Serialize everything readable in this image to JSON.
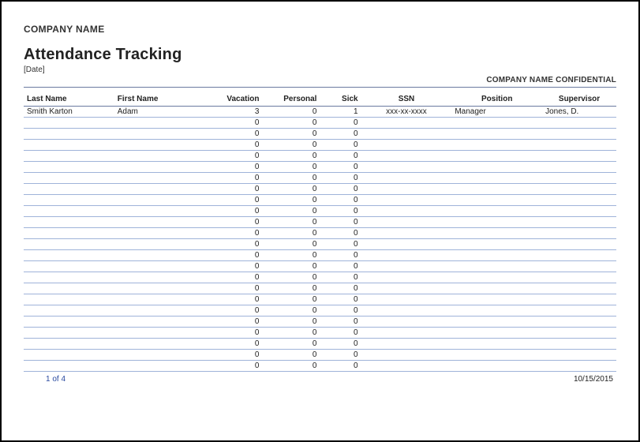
{
  "header": {
    "company_name": "COMPANY NAME",
    "title": "Attendance Tracking",
    "date_placeholder": "[Date]",
    "confidential": "COMPANY NAME CONFIDENTIAL"
  },
  "table": {
    "columns": {
      "last_name": "Last Name",
      "first_name": "First Name",
      "vacation": "Vacation",
      "personal": "Personal",
      "sick": "Sick",
      "ssn": "SSN",
      "position": "Position",
      "supervisor": "Supervisor"
    },
    "rows": [
      {
        "last_name": "Smith Karton",
        "first_name": "Adam",
        "vacation": "3",
        "personal": "0",
        "sick": "1",
        "ssn": "xxx-xx-xxxx",
        "position": "Manager",
        "supervisor": "Jones, D."
      },
      {
        "last_name": "",
        "first_name": "",
        "vacation": "0",
        "personal": "0",
        "sick": "0",
        "ssn": "",
        "position": "",
        "supervisor": ""
      },
      {
        "last_name": "",
        "first_name": "",
        "vacation": "0",
        "personal": "0",
        "sick": "0",
        "ssn": "",
        "position": "",
        "supervisor": ""
      },
      {
        "last_name": "",
        "first_name": "",
        "vacation": "0",
        "personal": "0",
        "sick": "0",
        "ssn": "",
        "position": "",
        "supervisor": ""
      },
      {
        "last_name": "",
        "first_name": "",
        "vacation": "0",
        "personal": "0",
        "sick": "0",
        "ssn": "",
        "position": "",
        "supervisor": ""
      },
      {
        "last_name": "",
        "first_name": "",
        "vacation": "0",
        "personal": "0",
        "sick": "0",
        "ssn": "",
        "position": "",
        "supervisor": ""
      },
      {
        "last_name": "",
        "first_name": "",
        "vacation": "0",
        "personal": "0",
        "sick": "0",
        "ssn": "",
        "position": "",
        "supervisor": ""
      },
      {
        "last_name": "",
        "first_name": "",
        "vacation": "0",
        "personal": "0",
        "sick": "0",
        "ssn": "",
        "position": "",
        "supervisor": ""
      },
      {
        "last_name": "",
        "first_name": "",
        "vacation": "0",
        "personal": "0",
        "sick": "0",
        "ssn": "",
        "position": "",
        "supervisor": ""
      },
      {
        "last_name": "",
        "first_name": "",
        "vacation": "0",
        "personal": "0",
        "sick": "0",
        "ssn": "",
        "position": "",
        "supervisor": ""
      },
      {
        "last_name": "",
        "first_name": "",
        "vacation": "0",
        "personal": "0",
        "sick": "0",
        "ssn": "",
        "position": "",
        "supervisor": ""
      },
      {
        "last_name": "",
        "first_name": "",
        "vacation": "0",
        "personal": "0",
        "sick": "0",
        "ssn": "",
        "position": "",
        "supervisor": ""
      },
      {
        "last_name": "",
        "first_name": "",
        "vacation": "0",
        "personal": "0",
        "sick": "0",
        "ssn": "",
        "position": "",
        "supervisor": ""
      },
      {
        "last_name": "",
        "first_name": "",
        "vacation": "0",
        "personal": "0",
        "sick": "0",
        "ssn": "",
        "position": "",
        "supervisor": ""
      },
      {
        "last_name": "",
        "first_name": "",
        "vacation": "0",
        "personal": "0",
        "sick": "0",
        "ssn": "",
        "position": "",
        "supervisor": ""
      },
      {
        "last_name": "",
        "first_name": "",
        "vacation": "0",
        "personal": "0",
        "sick": "0",
        "ssn": "",
        "position": "",
        "supervisor": ""
      },
      {
        "last_name": "",
        "first_name": "",
        "vacation": "0",
        "personal": "0",
        "sick": "0",
        "ssn": "",
        "position": "",
        "supervisor": ""
      },
      {
        "last_name": "",
        "first_name": "",
        "vacation": "0",
        "personal": "0",
        "sick": "0",
        "ssn": "",
        "position": "",
        "supervisor": ""
      },
      {
        "last_name": "",
        "first_name": "",
        "vacation": "0",
        "personal": "0",
        "sick": "0",
        "ssn": "",
        "position": "",
        "supervisor": ""
      },
      {
        "last_name": "",
        "first_name": "",
        "vacation": "0",
        "personal": "0",
        "sick": "0",
        "ssn": "",
        "position": "",
        "supervisor": ""
      },
      {
        "last_name": "",
        "first_name": "",
        "vacation": "0",
        "personal": "0",
        "sick": "0",
        "ssn": "",
        "position": "",
        "supervisor": ""
      },
      {
        "last_name": "",
        "first_name": "",
        "vacation": "0",
        "personal": "0",
        "sick": "0",
        "ssn": "",
        "position": "",
        "supervisor": ""
      },
      {
        "last_name": "",
        "first_name": "",
        "vacation": "0",
        "personal": "0",
        "sick": "0",
        "ssn": "",
        "position": "",
        "supervisor": ""
      },
      {
        "last_name": "",
        "first_name": "",
        "vacation": "0",
        "personal": "0",
        "sick": "0",
        "ssn": "",
        "position": "",
        "supervisor": ""
      }
    ]
  },
  "footer": {
    "page_number": "1 of 4",
    "print_date": "10/15/2015"
  }
}
